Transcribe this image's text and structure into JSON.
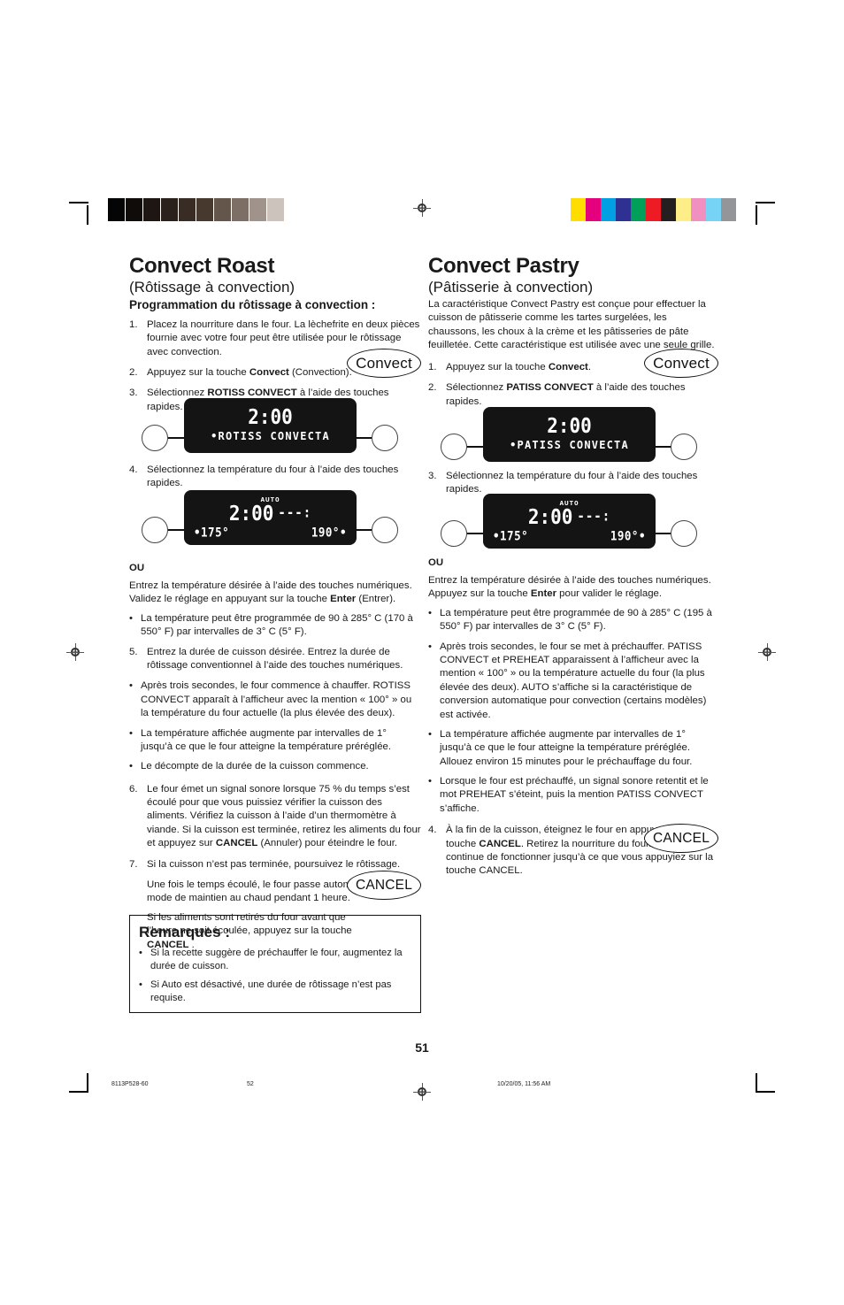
{
  "calibration": {
    "grayscale": [
      "#050505",
      "#100c0a",
      "#1d1613",
      "#2b211c",
      "#382c25",
      "#48392f",
      "#65564c",
      "#7e6f66",
      "#a0938b",
      "#cdc3bd",
      "#ffffff"
    ],
    "colors": [
      "#ffdd00",
      "#e5007e",
      "#00a0e3",
      "#2e3192",
      "#00a05a",
      "#ed1c24",
      "#231f20",
      "#fdee87",
      "#f18fc0",
      "#76d3f5",
      "#939598"
    ]
  },
  "left": {
    "title": "Convect Roast",
    "subtitle": "(Rôtissage à convection)",
    "section_head": "Programmation du rôtissage à convection :",
    "steps": [
      {
        "num": "1.",
        "text": "Placez la nourriture dans le four. La lèchefrite en deux pièces fournie avec votre four peut être utilisée pour le rôtissage avec convection."
      },
      {
        "num": "2.",
        "text": "Appuyez sur la touche ",
        "bold": "Convect",
        "tail": " (Convection)."
      },
      {
        "num": "3.",
        "text": "Sélectionnez ",
        "bold": "ROTISS CONVECT",
        "tail": " à l’aide des touches rapides."
      },
      {
        "num": "4.",
        "text": "Sélectionnez la température du four à l’aide des touches rapides."
      },
      {
        "num": "5.",
        "text": "Entrez la durée de cuisson désirée. Entrez la durée de rôtissage conventionnel à l’aide des touches numériques."
      },
      {
        "num": "6.",
        "text": "Le four émet un signal sonore lorsque 75 % du temps s’est écoulé pour que vous puissiez vérifier la cuisson des aliments. Vérifiez la cuisson à l’aide d’un thermomètre à viande. Si la cuisson est terminée, retirez les aliments du four et appuyez sur ",
        "bold": "CANCEL",
        "tail": " (Annuler) pour éteindre le four."
      },
      {
        "num": "7.",
        "text": "Si la cuisson n’est pas terminée, poursuivez le rôtissage."
      }
    ],
    "ou_label": "OU",
    "ou_text_a": "Entrez la température désirée à l’aide des touches numériques. Validez le réglage en appuyant sur la touche ",
    "ou_text_bold": "Enter",
    "ou_text_b": " (Entrer).",
    "bullet_temp_range": "La température peut être programmée de 90 à 285° C (170 à 550° F) par intervalles de 3° C (5° F).",
    "step5_bullets": [
      "Après trois secondes, le four commence à chauffer. ROTISS CONVECT apparaît à l’afficheur avec la mention « 100° » ou la température du four actuelle (la plus élevée des deux).",
      "La température affichée augmente par intervalles de 1° jusqu’à ce que le four atteigne la température préréglée.",
      "Le décompte de la durée de la cuisson commence."
    ],
    "step7_extra_a": "Une fois le temps écoulé, le four passe automatiquement au mode de maintien au chaud pendant 1 heure.",
    "step7_extra_b": "Si les aliments sont retirés du four avant que l’heure ne soit écoulée, appuyez sur la touche ",
    "step7_extra_bold": "CANCEL",
    "step7_extra_tail": " .",
    "key_convect": "Convect",
    "key_cancel": "CANCEL",
    "display1": {
      "time": "2:00",
      "mode": "•ROTISS CONVECTA"
    },
    "display2": {
      "auto": "AUTO",
      "time": "2:00",
      "dash": "---:",
      "left_temp": "•175°",
      "right_temp": "190°•"
    }
  },
  "right": {
    "title": "Convect Pastry",
    "subtitle": "(Pâtisserie à convection)",
    "intro": "La caractéristique Convect Pastry est conçue pour effectuer la cuisson de pâtisserie comme les tartes surgelées, les chaussons, les choux à la crème et les pâtisseries de pâte feuilletée. Cette caractéristique est utilisée avec une seule grille.",
    "steps": [
      {
        "num": "1.",
        "text": "Appuyez sur la touche ",
        "bold": "Convect",
        "tail": "."
      },
      {
        "num": "2.",
        "text": "Sélectionnez ",
        "bold": "PATISS CONVECT",
        "tail": " à l’aide des touches rapides."
      },
      {
        "num": "3.",
        "text": "Sélectionnez la température du four à l’aide des touches rapides."
      },
      {
        "num": "4.",
        "text": "À la fin de la cuisson, éteignez le four en appuyant sur la touche ",
        "bold": "CANCEL",
        "tail": ".  Retirez la nourriture du four. Le four continue de fonctionner jusqu’à ce que vous appuyiez sur la touche CANCEL."
      }
    ],
    "ou_label": "OU",
    "ou_text_a": "Entrez la température désirée à l’aide des touches numériques. Appuyez sur la touche ",
    "ou_text_bold": "Enter",
    "ou_text_b": " pour valider le réglage.",
    "bullets": [
      "La température peut être programmée de 90 à 285° C (195 à 550° F) par intervalles de 3° C (5° F).",
      "Après trois secondes, le four se met à préchauffer. PATISS CONVECT et PREHEAT apparaissent à l’afficheur avec la mention « 100° » ou la température actuelle du four (la plus élevée des deux). AUTO s’affiche si la caractéristique de conversion automatique pour convection (certains modèles) est activée.",
      "La température affichée augmente par intervalles de 1° jusqu’à ce que le four atteigne la température préréglée. Allouez environ 15 minutes pour le préchauffage du four.",
      "Lorsque le four est préchauffé, un signal sonore retentit et le mot PREHEAT s’éteint, puis la mention PATISS CONVECT s’affiche."
    ],
    "key_convect": "Convect",
    "key_cancel": "CANCEL",
    "display1": {
      "time": "2:00",
      "mode": "•PATISS CONVECTA"
    },
    "display2": {
      "auto": "AUTO",
      "time": "2:00",
      "dash": "---:",
      "left_temp": "•175°",
      "right_temp": "190°•"
    }
  },
  "footer": {
    "page_number": "51",
    "doc_code": "8113P528-60",
    "sheet_number": "52",
    "timestamp": "10/20/05, 11:56 AM"
  }
}
